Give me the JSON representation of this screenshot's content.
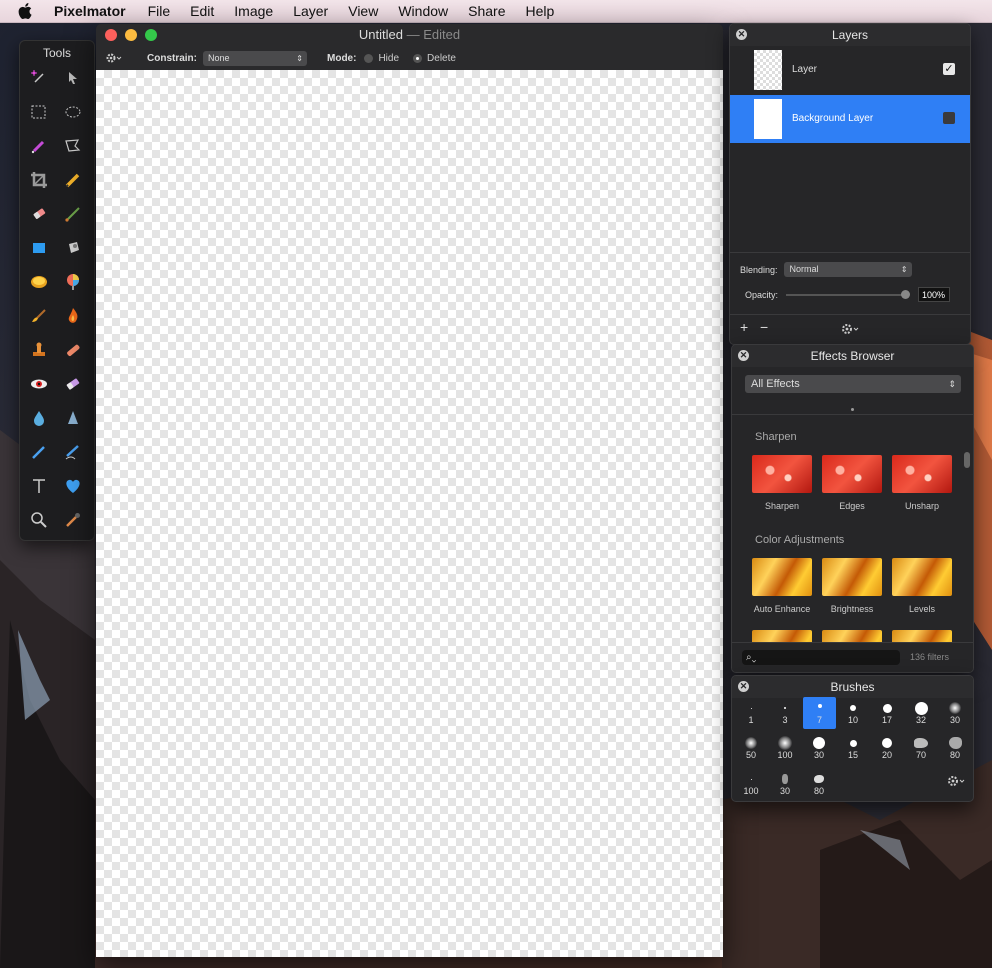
{
  "menubar": {
    "app": "Pixelmator",
    "items": [
      "File",
      "Edit",
      "Image",
      "Layer",
      "View",
      "Window",
      "Share",
      "Help"
    ]
  },
  "tools": {
    "title": "Tools",
    "items": [
      "magic-wand-icon",
      "arrow-icon",
      "rect-select-icon",
      "ellipse-select-icon",
      "quick-select-icon",
      "lasso-icon",
      "crop-icon",
      "pencil-icon",
      "eraser-icon",
      "brush-icon",
      "shape-icon",
      "bucket-icon",
      "gradient-icon",
      "color-picker-icon",
      "smudge-icon",
      "burn-icon",
      "stamp-icon",
      "bandage-icon",
      "red-eye-icon",
      "eraser2-icon",
      "drop-icon",
      "cone-icon",
      "pen-icon",
      "freeform-pen-icon",
      "type-icon",
      "heart-icon",
      "zoom-icon",
      "eyedropper-icon"
    ]
  },
  "document": {
    "title": "Untitled",
    "edited": "— Edited",
    "constrain_label": "Constrain:",
    "constrain_value": "None",
    "mode_label": "Mode:",
    "mode_hide": "Hide",
    "mode_delete": "Delete"
  },
  "layers": {
    "title": "Layers",
    "rows": [
      {
        "name": "Layer",
        "checked": true
      },
      {
        "name": "Background Layer",
        "checked": false
      }
    ],
    "blending_label": "Blending:",
    "blending_value": "Normal",
    "opacity_label": "Opacity:",
    "opacity_value": "100%",
    "opacity": 1.0,
    "add": "+",
    "remove": "−"
  },
  "effects": {
    "title": "Effects Browser",
    "filter": "All Effects",
    "sections": [
      {
        "name": "Sharpen",
        "items": [
          "Sharpen",
          "Edges",
          "Unsharp"
        ]
      },
      {
        "name": "Color Adjustments",
        "items": [
          "Auto Enhance",
          "Brightness",
          "Levels"
        ]
      }
    ],
    "count": "136 filters"
  },
  "brushes": {
    "title": "Brushes",
    "sizes": [
      "1",
      "3",
      "7",
      "10",
      "17",
      "32",
      "30",
      "50",
      "100",
      "30",
      "15",
      "20",
      "70",
      "80",
      "100",
      "30",
      "80"
    ],
    "selected": "7"
  },
  "colors": {
    "selection": "#2f7ff5",
    "close": "#fc605c",
    "minimize": "#fdbc40",
    "zoom": "#34c84a"
  }
}
